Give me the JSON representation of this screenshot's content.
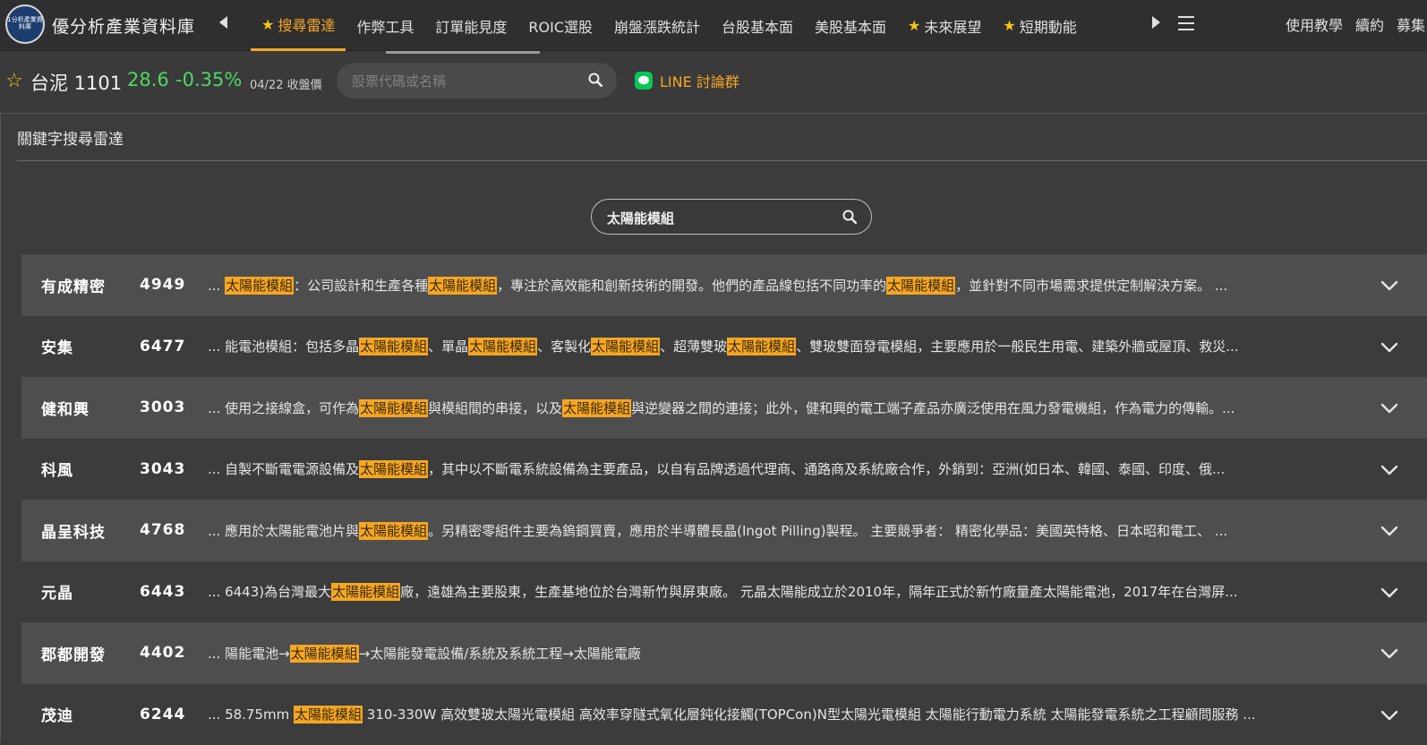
{
  "header": {
    "logo_text": "1分析產業資料庫",
    "brand": "優分析產業資料庫",
    "tabs": [
      {
        "label": "搜尋雷達",
        "star": true,
        "active": true
      },
      {
        "label": "作弊工具",
        "star": false,
        "active": false
      },
      {
        "label": "訂單能見度",
        "star": false,
        "active": false
      },
      {
        "label": "ROIC選股",
        "star": false,
        "active": false
      },
      {
        "label": "崩盤漲跌統計",
        "star": false,
        "active": false
      },
      {
        "label": "台股基本面",
        "star": false,
        "active": false
      },
      {
        "label": "美股基本面",
        "star": false,
        "active": false
      },
      {
        "label": "未來展望",
        "star": true,
        "active": false
      },
      {
        "label": "短期動能",
        "star": true,
        "active": false
      }
    ],
    "right_links": [
      "使用教學",
      "續約",
      "募集"
    ]
  },
  "stock": {
    "name": "台泥 1101",
    "price": "28.6",
    "change": "-0.35%",
    "date_label": "04/22 收盤價",
    "change_color": "#4cd964"
  },
  "search": {
    "placeholder": "股票代碼或名稱"
  },
  "line": {
    "label": "LINE 討論群"
  },
  "panel": {
    "title": "關鍵字搜尋雷達",
    "keyword": "太陽能模組"
  },
  "accent_color": "#f5a623",
  "results": [
    {
      "name": "有成精密",
      "code": "4949",
      "parts": [
        "... ",
        "太陽能模組",
        "：公司設計和生產各種",
        "太陽能模組",
        "，專注於高效能和創新技術的開發。他們的產品線包括不同功率的",
        "太陽能模組",
        "，並針對不同市場需求提供定制解決方案。 ..."
      ]
    },
    {
      "name": "安集",
      "code": "6477",
      "parts": [
        "... 能電池模組：包括多晶",
        "太陽能模組",
        "、單晶",
        "太陽能模組",
        "、客製化",
        "太陽能模組",
        "、超薄雙玻",
        "太陽能模組",
        "、雙玻雙面發電模組，主要應用於一般民生用電、建築外牆或屋頂、救災..."
      ]
    },
    {
      "name": "健和興",
      "code": "3003",
      "parts": [
        "... 使用之接線盒，可作為",
        "太陽能模組",
        "與模組間的串接，以及",
        "太陽能模組",
        "與逆變器之間的連接；此外，健和興的電工端子產品亦廣泛使用在風力發電機組，作為電力的傳輸。..."
      ]
    },
    {
      "name": "科風",
      "code": "3043",
      "parts": [
        "... 自製不斷電電源設備及",
        "太陽能模組",
        "，其中以不斷電系統設備為主要產品，以自有品牌透過代理商、通路商及系統廠合作，外銷到：亞洲(如日本、韓國、泰國、印度、俄..."
      ]
    },
    {
      "name": "晶呈科技",
      "code": "4768",
      "parts": [
        "... 應用於太陽能電池片與",
        "太陽能模組",
        "。另精密零組件主要為鎢鋼買賣，應用於半導體長晶(Ingot Pilling)製程。 主要競爭者： 精密化學品：美國英特格、日本昭和電工、 ..."
      ]
    },
    {
      "name": "元晶",
      "code": "6443",
      "parts": [
        "... 6443)為台灣最大",
        "太陽能模組",
        "廠，遠雄為主要股東，生產基地位於台灣新竹與屏東廠。 元晶太陽能成立於2010年，隔年正式於新竹廠量產太陽能電池，2017年在台灣屏..."
      ]
    },
    {
      "name": "郡都開發",
      "code": "4402",
      "parts": [
        "... 陽能電池→",
        "太陽能模組",
        "→太陽能發電設備/系統及系統工程→太陽能電廠"
      ]
    },
    {
      "name": "茂迪",
      "code": "6244",
      "parts": [
        "... 58.75mm ",
        "太陽能模組",
        " 310-330W 高效雙玻太陽光電模組 高效率穿隧式氧化層鈍化接觸(TOPCon)N型太陽光電模組 太陽能行動電力系統 太陽能發電系統之工程顧問服務 ..."
      ]
    }
  ]
}
